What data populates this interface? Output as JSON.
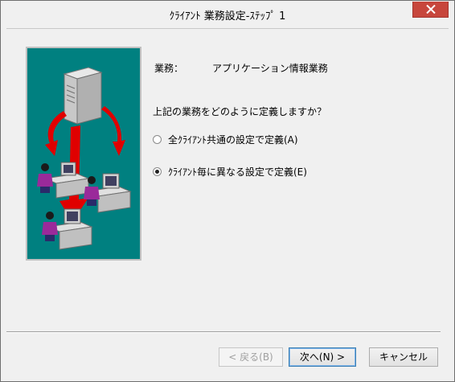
{
  "window": {
    "title": "ｸﾗｲｱﾝﾄ 業務設定-ｽﾃｯﾌﾟ 1",
    "close_icon": "close-icon"
  },
  "content": {
    "field_label": "業務：",
    "field_value": "アプリケーション情報業務",
    "question": "上記の業務をどのように定義しますか？",
    "options": [
      {
        "label": "全ｸﾗｲｱﾝﾄ共通の設定で定義(A)",
        "selected": false
      },
      {
        "label": "ｸﾗｲｱﾝﾄ毎に異なる設定で定義(E)",
        "selected": true
      }
    ]
  },
  "buttons": {
    "back": "< 戻る(B)",
    "next": "次へ(N) >",
    "cancel": "キャンセル"
  },
  "colors": {
    "illustration_bg": "#008080",
    "arrow": "#e00000",
    "close_button": "#c7463c"
  }
}
